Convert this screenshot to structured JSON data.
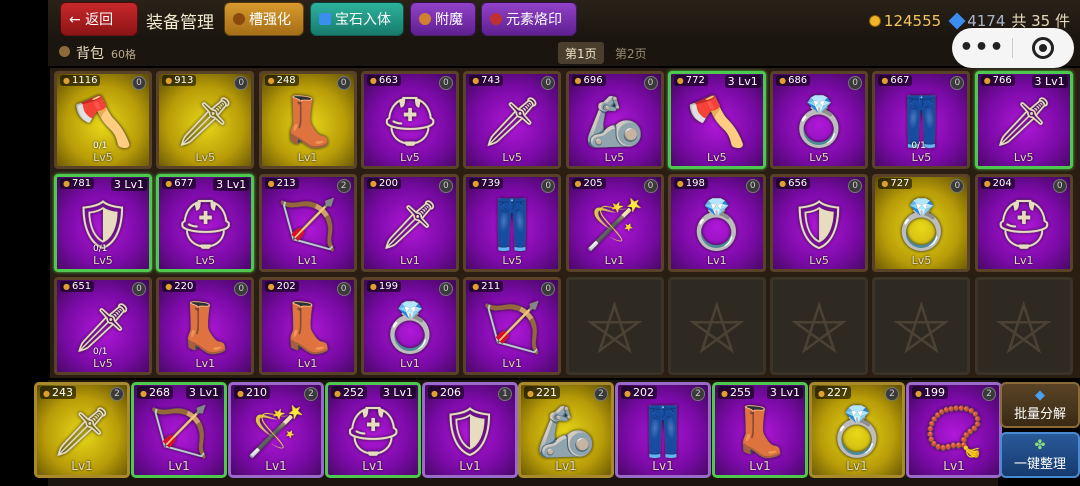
{
  "topbar": {
    "back_label": "← 返回",
    "title": "装备管理",
    "tabs": [
      "槽强化",
      "宝石入体",
      "附魔",
      "元素烙印"
    ],
    "gold": "124555",
    "gems": "4174",
    "count": "共 35 件"
  },
  "subbar": {
    "bag_label": "背包",
    "capacity": "60格",
    "page1": "第1页",
    "page2": "第2页"
  },
  "capsule": {
    "more": "•••"
  },
  "grid": [
    {
      "num": "1116",
      "bg": "yellow",
      "icon": "🪓",
      "lv": "Lv5",
      "frac": "0/1",
      "slot": "0"
    },
    {
      "num": "913",
      "bg": "yellow",
      "icon": "🗡",
      "lv": "Lv5",
      "slot": "0"
    },
    {
      "num": "248",
      "bg": "yellow",
      "icon": "👢",
      "lv": "Lv1",
      "slot": "0"
    },
    {
      "num": "663",
      "bg": "purple",
      "icon": "⛑",
      "lv": "Lv5",
      "slot": "0"
    },
    {
      "num": "743",
      "bg": "purple",
      "icon": "🗡",
      "lv": "Lv5",
      "slot": "0"
    },
    {
      "num": "696",
      "bg": "purple",
      "icon": "🦾",
      "lv": "Lv5",
      "slot": "0"
    },
    {
      "num": "772",
      "bg": "purple",
      "icon": "🪓",
      "lv": "Lv5",
      "tag": "3 Lv1",
      "sel": true
    },
    {
      "num": "686",
      "bg": "purple",
      "icon": "💍",
      "lv": "Lv5",
      "slot": "0"
    },
    {
      "num": "667",
      "bg": "purple",
      "icon": "👖",
      "lv": "Lv5",
      "frac": "0/1",
      "slot": "0"
    },
    {
      "num": "766",
      "bg": "purple",
      "icon": "🗡",
      "lv": "Lv5",
      "tag": "3 Lv1",
      "sel": true
    },
    {
      "num": "781",
      "bg": "purple",
      "icon": "🛡",
      "lv": "Lv5",
      "frac": "0/1",
      "tag": "3 Lv1",
      "sel": true
    },
    {
      "num": "677",
      "bg": "purple",
      "icon": "⛑",
      "lv": "Lv5",
      "tag": "3 Lv1",
      "sel": true
    },
    {
      "num": "213",
      "bg": "purple",
      "icon": "🏹",
      "lv": "Lv1",
      "slot": "2"
    },
    {
      "num": "200",
      "bg": "purple",
      "icon": "🗡",
      "lv": "Lv1",
      "slot": "0"
    },
    {
      "num": "739",
      "bg": "purple",
      "icon": "👖",
      "lv": "Lv5",
      "slot": "0"
    },
    {
      "num": "205",
      "bg": "purple",
      "icon": "🪄",
      "lv": "Lv1",
      "slot": "0"
    },
    {
      "num": "198",
      "bg": "purple",
      "icon": "💍",
      "lv": "Lv1",
      "slot": "0"
    },
    {
      "num": "656",
      "bg": "purple",
      "icon": "🛡",
      "lv": "Lv5",
      "slot": "0"
    },
    {
      "num": "727",
      "bg": "yellow",
      "icon": "💍",
      "lv": "Lv5",
      "slot": "0"
    },
    {
      "num": "204",
      "bg": "purple",
      "icon": "⛑",
      "lv": "Lv1",
      "slot": "0"
    },
    {
      "num": "651",
      "bg": "purple",
      "icon": "🗡",
      "lv": "Lv5",
      "frac": "0/1",
      "slot": "0"
    },
    {
      "num": "220",
      "bg": "purple",
      "icon": "👢",
      "lv": "Lv1",
      "slot": "0"
    },
    {
      "num": "202",
      "bg": "purple",
      "icon": "👢",
      "lv": "Lv1",
      "slot": "0"
    },
    {
      "num": "199",
      "bg": "purple",
      "icon": "💍",
      "lv": "Lv1",
      "slot": "0"
    },
    {
      "num": "211",
      "bg": "purple",
      "icon": "🏹",
      "lv": "Lv1",
      "slot": "0"
    }
  ],
  "bottom": [
    {
      "num": "243",
      "bg": "yellow",
      "icon": "🗡",
      "lv": "Lv1",
      "slot": "2"
    },
    {
      "num": "268",
      "bg": "purple",
      "icon": "🏹",
      "lv": "Lv1",
      "tag": "3 Lv1",
      "sel": true
    },
    {
      "num": "210",
      "bg": "purple",
      "icon": "🪄",
      "lv": "Lv1",
      "slot": "2"
    },
    {
      "num": "252",
      "bg": "purple",
      "icon": "⛑",
      "lv": "Lv1",
      "tag": "3 Lv1",
      "sel": true
    },
    {
      "num": "206",
      "bg": "purple",
      "icon": "🛡",
      "lv": "Lv1",
      "slot": "1"
    },
    {
      "num": "221",
      "bg": "yellow",
      "icon": "🦾",
      "lv": "Lv1",
      "slot": "2"
    },
    {
      "num": "202",
      "bg": "purple",
      "icon": "👖",
      "lv": "Lv1",
      "slot": "2"
    },
    {
      "num": "255",
      "bg": "purple",
      "icon": "👢",
      "lv": "Lv1",
      "tag": "3 Lv1",
      "sel": true
    },
    {
      "num": "227",
      "bg": "yellow",
      "icon": "💍",
      "lv": "Lv1",
      "slot": "2"
    },
    {
      "num": "199",
      "bg": "purple",
      "icon": "📿",
      "lv": "Lv1",
      "slot": "2"
    }
  ],
  "side": {
    "split_label": "批量分解",
    "sort_label": "一键整理"
  },
  "colors": {
    "selected": "#4ec84e",
    "purple": "#7a0aa6",
    "yellow": "#b89c08"
  }
}
